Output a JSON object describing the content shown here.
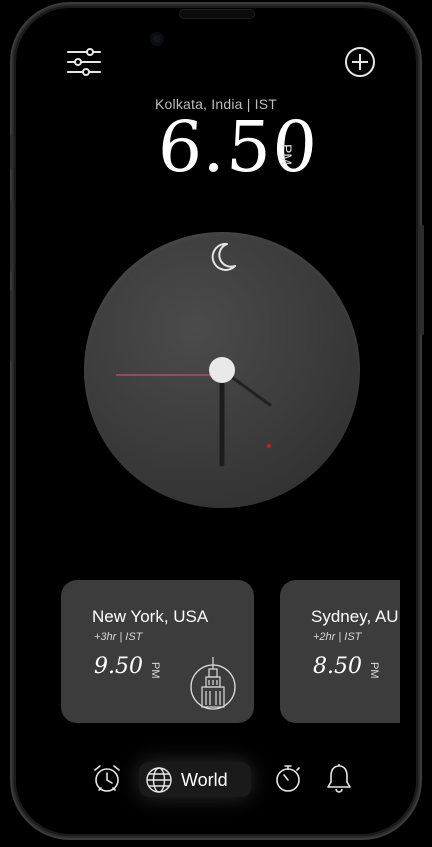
{
  "header": {
    "location": "Kolkata, India | IST",
    "time": "6.50",
    "ampm": "PM",
    "menu_icon": "sliders-icon",
    "add_icon": "plus-circle-icon"
  },
  "clock": {
    "phase_icon": "moon-icon",
    "accent_color": "#d7568b",
    "second_dot_color": "#e0141d"
  },
  "cities": [
    {
      "name": "New York, USA",
      "diff": "+3hr | IST",
      "time": "9.50",
      "ampm": "PM",
      "icon": "empire-state-icon"
    },
    {
      "name": "Sydney, AU",
      "diff": "+2hr | IST",
      "time": "8.50",
      "ampm": "PM"
    }
  ],
  "nav": {
    "alarm_icon": "alarm-clock-icon",
    "world_label": "World",
    "world_icon": "globe-icon",
    "timer_icon": "stopwatch-icon",
    "bell_icon": "bell-icon"
  }
}
